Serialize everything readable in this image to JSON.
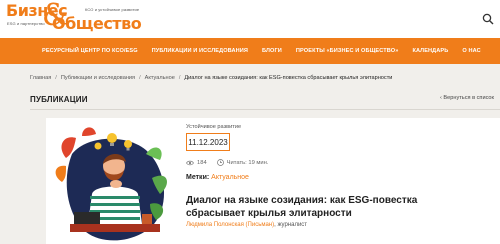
{
  "brand": {
    "word1": "Бизнес",
    "amp": "&",
    "word2": "Общество",
    "tagline1": "КСО и устойчивое развитие",
    "tagline2": "ESG и партнерство",
    "accent_color": "#f07d1a"
  },
  "header": {
    "search_icon": "search-icon"
  },
  "nav": {
    "items": [
      {
        "label": "РЕСУРСНЫЙ ЦЕНТР ПО КСО/ESG"
      },
      {
        "label": "ПУБЛИКАЦИИ И ИССЛЕДОВАНИЯ"
      },
      {
        "label": "БЛОГИ"
      },
      {
        "label": "ПРОЕКТЫ «БИЗНЕС И ОБЩЕСТВО»"
      },
      {
        "label": "КАЛЕНДАРЬ"
      },
      {
        "label": "О НАС"
      }
    ]
  },
  "breadcrumb": {
    "items": [
      "Главная",
      "Публикации и исследования",
      "Актуальное"
    ],
    "separator": "/",
    "current": "Диалог на языке созидания: как ESG-повестка сбрасывает крылья элитарности"
  },
  "page": {
    "title": "ПУБЛИКАЦИИ",
    "back_link": "‹ Вернуться в список"
  },
  "article": {
    "category": "Устойчивое развитие",
    "date": "11.12.2023",
    "views": "184",
    "read_time": "Читать: 19 мин.",
    "tags_label": "Метки:",
    "tag": "Актуальное",
    "title": "Диалог на языке созидания: как ESG-повестка сбрасывает крылья элитарности",
    "author_name": "Людмила Полонская (Письман)",
    "author_role": ", журналист"
  }
}
